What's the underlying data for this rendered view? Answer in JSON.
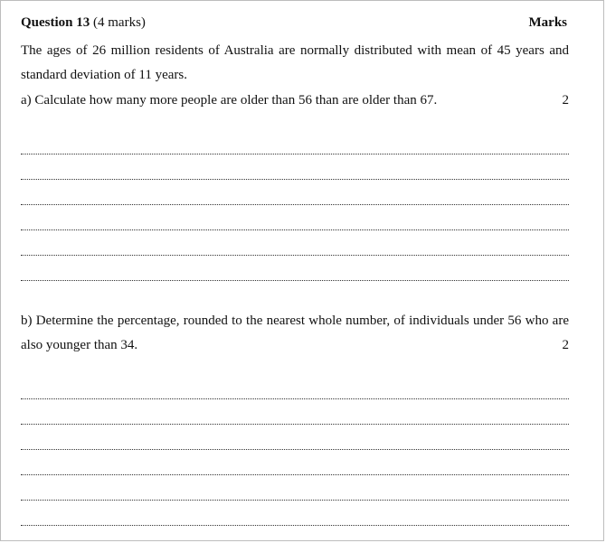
{
  "question": {
    "number_label": "Question 13",
    "marks_label": "(4 marks)",
    "marks_heading": "Marks",
    "intro": "The ages of 26 million residents of Australia are normally distributed with mean of 45 years and standard deviation of 11 years."
  },
  "parts": [
    {
      "text": "a) Calculate how many more people are older than 56 than are older than 67.",
      "marks": "2"
    },
    {
      "text": "b) Determine the percentage, rounded to the nearest whole number, of individuals under 56 who are also younger than 34.",
      "marks": "2"
    }
  ]
}
